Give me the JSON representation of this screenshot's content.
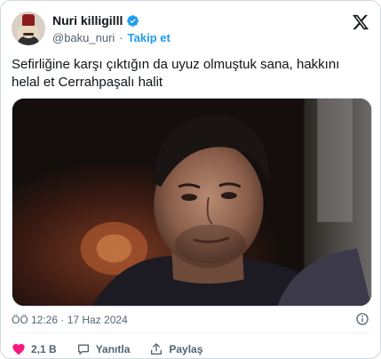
{
  "author": {
    "display_name": "Nuri killigilll",
    "handle": "@baku_nuri",
    "separator": "·",
    "follow_label": "Takip et"
  },
  "tweet": {
    "text": "Sefirliğine karşı çıktığın da uyuz olmuştuk sana, hakkını helal et Cerrahpaşalı halit",
    "timestamp": "ÖÖ 12:26 · 17 Haz 2024"
  },
  "actions": {
    "like_count": "2,1 B",
    "reply_label": "Yanıtla",
    "share_label": "Paylaş"
  },
  "colors": {
    "accent": "#1d9bf0",
    "like": "#f91880",
    "muted": "#536471",
    "text": "#0f1419"
  },
  "icons": {
    "verified": "verified-badge-icon",
    "x_logo": "x-logo-icon",
    "info": "info-icon",
    "like": "heart-icon",
    "reply": "speech-bubble-icon",
    "share": "share-icon"
  }
}
